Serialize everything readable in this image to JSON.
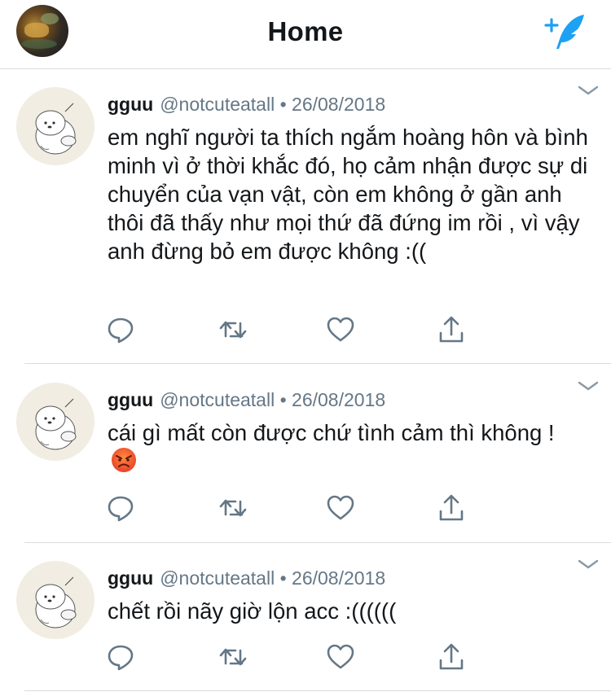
{
  "header": {
    "title": "Home",
    "profile_avatar": "profile-photo",
    "compose_icon": "compose-tweet-icon"
  },
  "colors": {
    "icon_gray": "#657786",
    "text": "#14171a",
    "accent": "#1da1f2",
    "divider": "#d8dde1"
  },
  "tweets": [
    {
      "name": "gguu",
      "handle": "@notcuteatall",
      "separator": "•",
      "date": "26/08/2018",
      "text": "em nghĩ người ta thích ngắm hoàng hôn và bình minh vì ở thời khắc đó, họ cảm nhận được sự di chuyển của vạn vật, còn em không ở gần anh thôi đã thấy như mọi thứ đã đứng im rồi , vì vậy anh đừng bỏ em được không :(("
    },
    {
      "name": "gguu",
      "handle": "@notcuteatall",
      "separator": "•",
      "date": "26/08/2018",
      "text": "cái gì mất còn được chứ tình cảm thì không ! ",
      "emoji": "angry-face"
    },
    {
      "name": "gguu",
      "handle": "@notcuteatall",
      "separator": "•",
      "date": "26/08/2018",
      "text": "chết rồi nãy giờ lộn acc :(((((("
    }
  ]
}
